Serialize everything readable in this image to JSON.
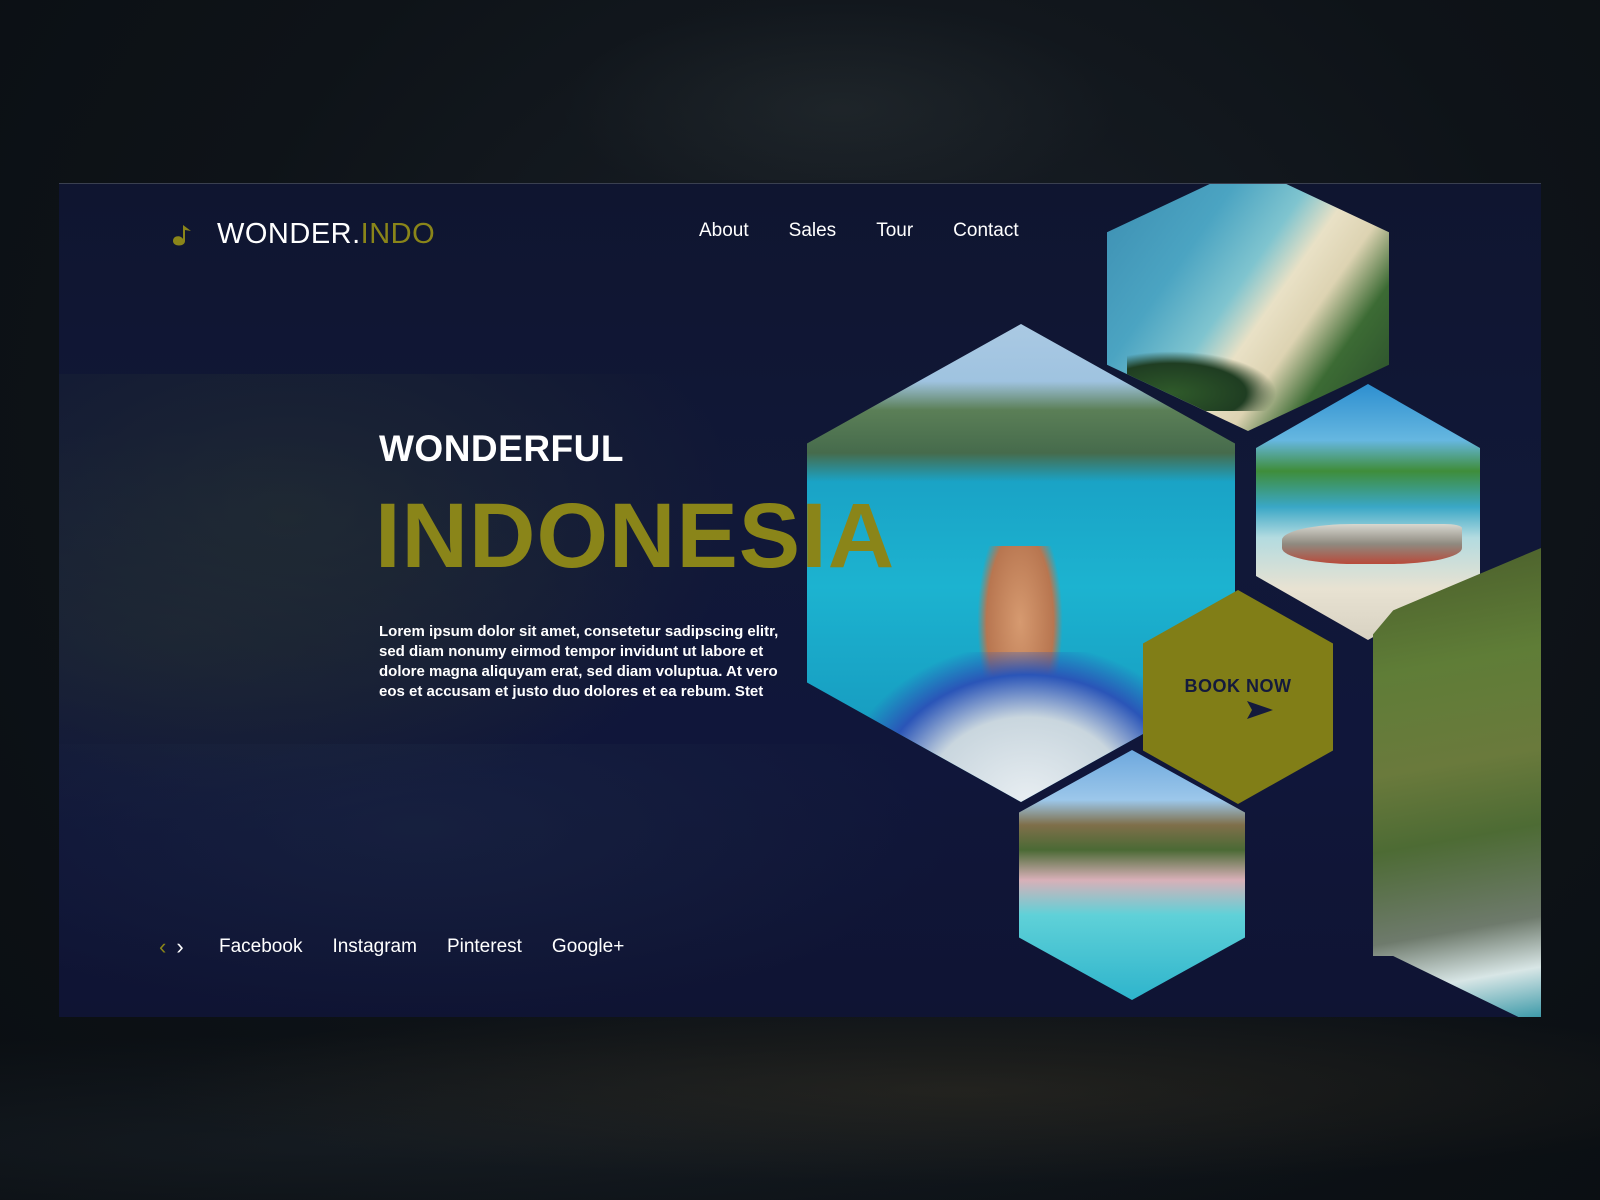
{
  "brand": {
    "name_primary": "WONDER.",
    "name_accent": "INDO",
    "logo_icon": "music-note-icon",
    "accent_color": "#8a8519"
  },
  "nav": {
    "items": [
      {
        "label": "About"
      },
      {
        "label": "Sales"
      },
      {
        "label": "Tour"
      },
      {
        "label": "Contact"
      }
    ]
  },
  "hero": {
    "kicker": "WONDERFUL",
    "title": "INDONESIA",
    "description": "Lorem ipsum dolor sit amet, consetetur sadipscing elitr, sed diam nonumy eirmod tempor invidunt ut labore et dolore magna aliquyam erat, sed diam voluptua. At vero eos et accusam et justo duo dolores et ea rebum. Stet"
  },
  "cta": {
    "label": "BOOK NOW",
    "icon": "send-arrow-icon",
    "color": "#817e17"
  },
  "footer": {
    "prev_icon": "chevron-left-icon",
    "next_icon": "chevron-right-icon",
    "prev_glyph": "‹",
    "next_glyph": "›",
    "socials": [
      {
        "label": "Facebook"
      },
      {
        "label": "Instagram"
      },
      {
        "label": "Pinterest"
      },
      {
        "label": "Google+"
      }
    ]
  },
  "gallery": {
    "images": [
      "beach-photo",
      "boat-woman-photo",
      "beached-boat-photo",
      "coastline-photo",
      "pink-lagoon-photo"
    ]
  }
}
